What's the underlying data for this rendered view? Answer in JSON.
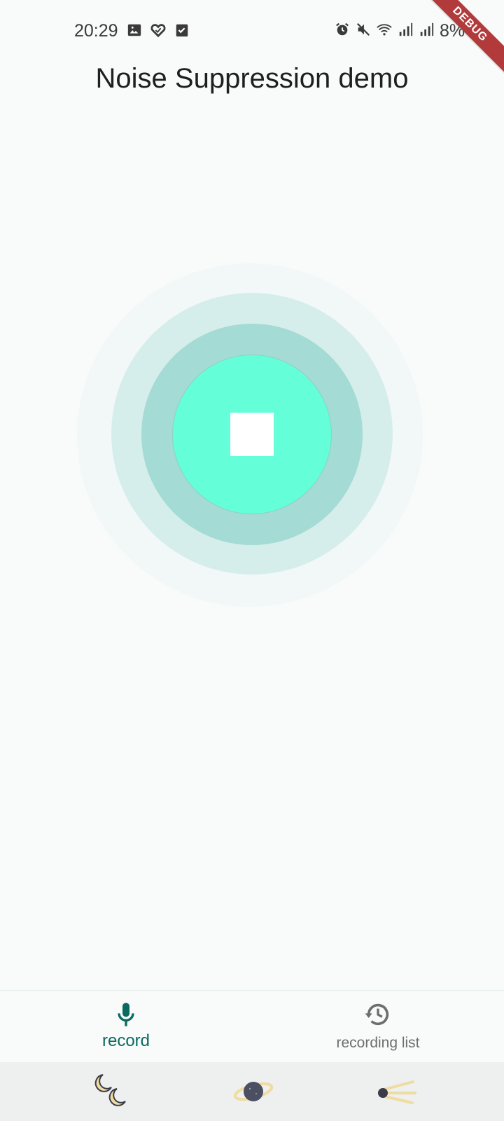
{
  "status_bar": {
    "time": "20:29",
    "battery": "8%",
    "left_icons": [
      "image-icon",
      "health-icon",
      "checkbox-icon"
    ],
    "right_icons": [
      "alarm-icon",
      "mute-icon",
      "wifi-icon",
      "signal-icon",
      "signal-icon"
    ]
  },
  "debug_banner": "DEBUG",
  "header": {
    "title": "Noise Suppression demo"
  },
  "recorder": {
    "state": "recording",
    "button_icon": "stop-icon",
    "colors": {
      "inner": "#64ffd9",
      "mid": "#a4dbd4",
      "outer": "#d6eeeb"
    }
  },
  "bottom_nav": {
    "items": [
      {
        "label": "record",
        "icon": "mic-icon",
        "selected": true
      },
      {
        "label": "recording list",
        "icon": "history-icon",
        "selected": false
      }
    ],
    "accent": "#0a6a60"
  },
  "system_nav": {
    "icons": [
      "moons-icon",
      "planet-icon",
      "comet-icon"
    ]
  }
}
